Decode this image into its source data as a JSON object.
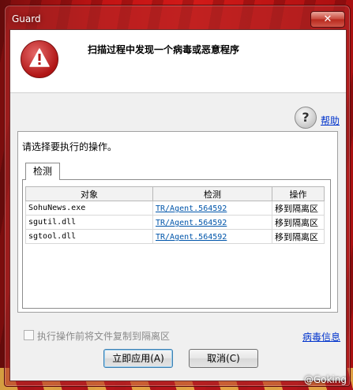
{
  "window": {
    "title": "Guard",
    "close_glyph": "✕"
  },
  "header": {
    "title": "扫描过程中发现一个病毒或恶意程序",
    "icon": "warning-icon"
  },
  "help": {
    "icon_glyph": "?",
    "label": "帮助"
  },
  "prompt": "请选择要执行的操作。",
  "tab_label": "检测",
  "table": {
    "columns": [
      "对象",
      "检测",
      "操作"
    ],
    "rows": [
      {
        "object": "SohuNews.exe",
        "detection": "TR/Agent.564592",
        "action": "移到隔离区"
      },
      {
        "object": "sgutil.dll",
        "detection": "TR/Agent.564592",
        "action": "移到隔离区"
      },
      {
        "object": "sgtool.dll",
        "detection": "TR/Agent.564592",
        "action": "移到隔离区"
      }
    ]
  },
  "footer": {
    "checkbox_label": "执行操作前将文件复制到隔离区",
    "virus_info_link": "病毒信息",
    "apply_button": "立即应用(A)",
    "cancel_button": "取消(C)"
  },
  "watermark": "@Goking",
  "colors": {
    "accent_red": "#b01515",
    "link_blue": "#0033cc"
  }
}
